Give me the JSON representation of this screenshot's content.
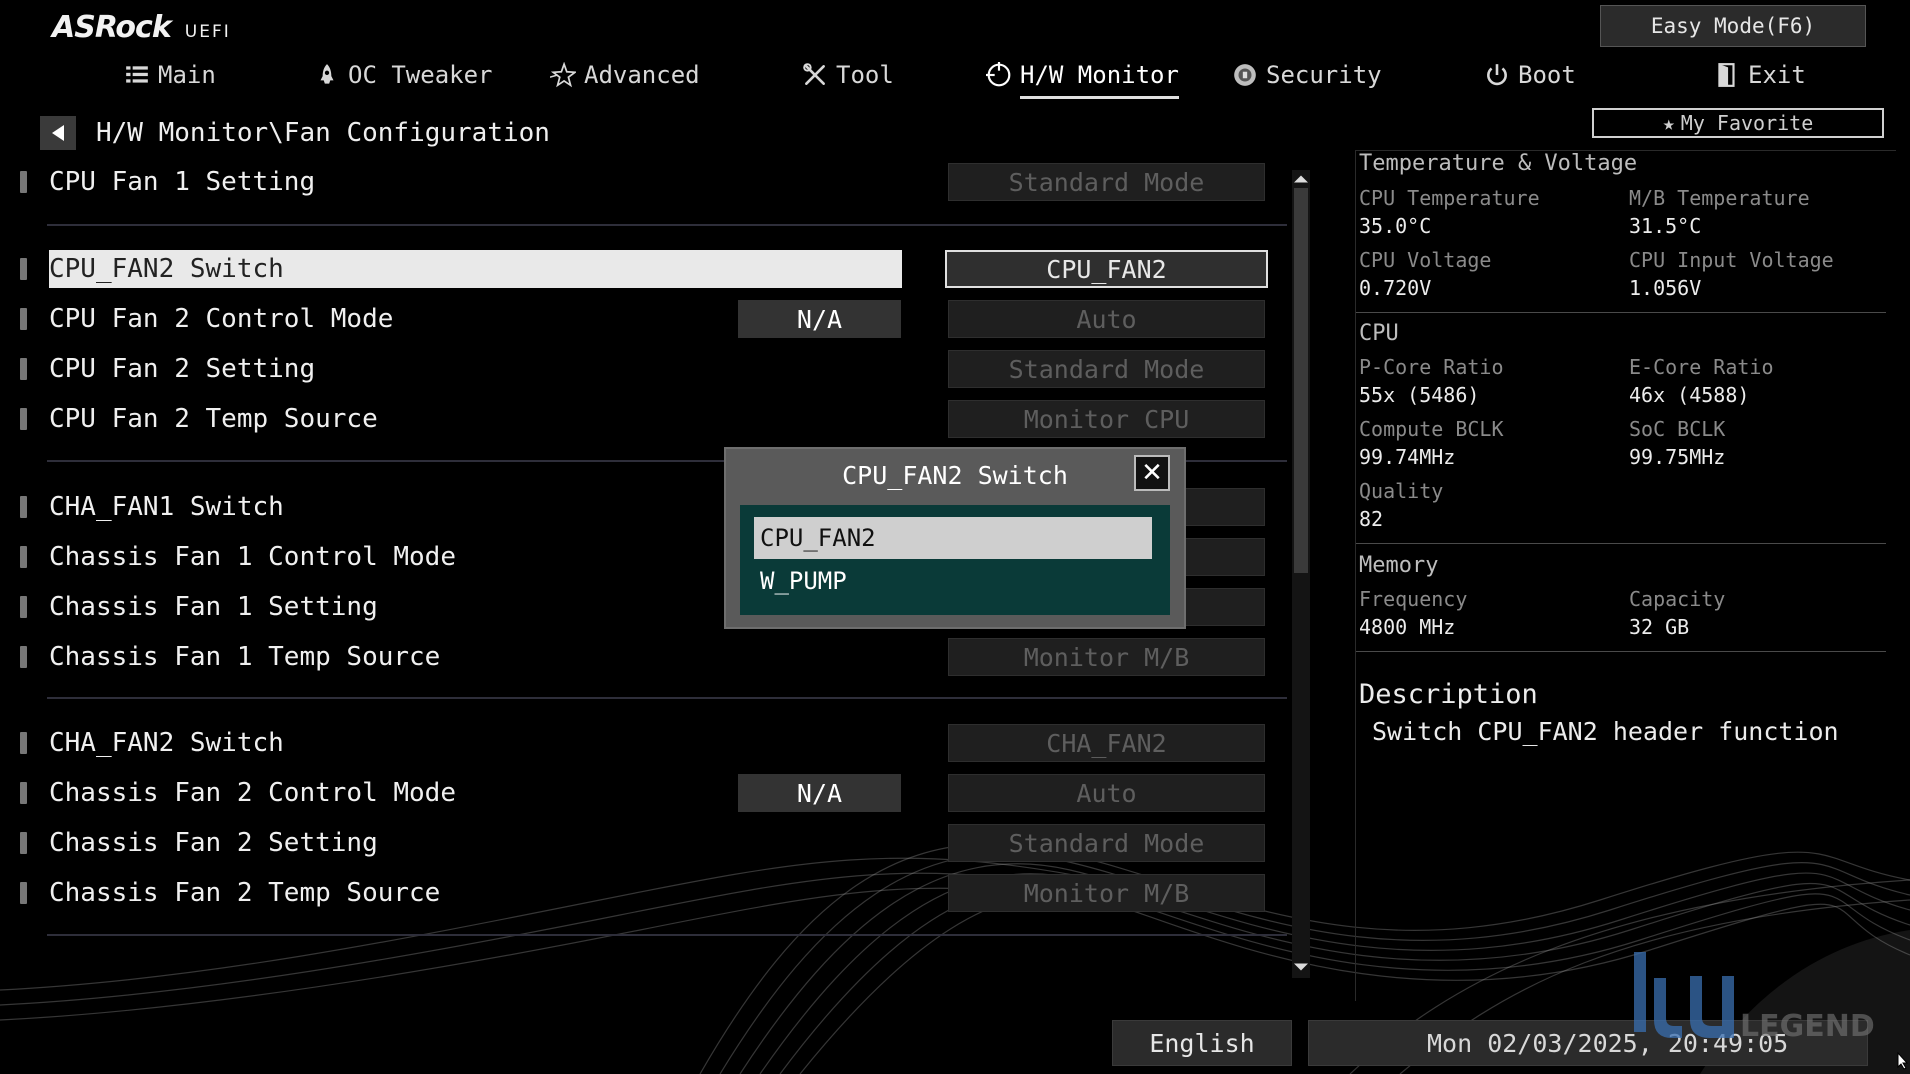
{
  "brand": {
    "name": "ASRock",
    "sub": "UEFI"
  },
  "easy_mode_label": "Easy Mode(F6)",
  "tabs": [
    {
      "label": "Main",
      "icon": "list-icon"
    },
    {
      "label": "OC Tweaker",
      "icon": "rocket-icon"
    },
    {
      "label": "Advanced",
      "icon": "star-icon"
    },
    {
      "label": "Tool",
      "icon": "tools-icon"
    },
    {
      "label": "H/W Monitor",
      "icon": "monitor-icon",
      "active": true
    },
    {
      "label": "Security",
      "icon": "shield-icon"
    },
    {
      "label": "Boot",
      "icon": "power-icon"
    },
    {
      "label": "Exit",
      "icon": "exit-door-icon"
    }
  ],
  "favorite_label": "My Favorite",
  "breadcrumb": "H/W Monitor\\Fan Configuration",
  "settings": [
    {
      "label": "CPU Fan 1 Setting",
      "value": "Standard Mode"
    },
    {
      "label": "CPU_FAN2 Switch",
      "value": "CPU_FAN2",
      "selected": true
    },
    {
      "label": "CPU Fan 2 Control Mode",
      "na": "N/A",
      "value": "Auto"
    },
    {
      "label": "CPU Fan 2 Setting",
      "value": "Standard Mode"
    },
    {
      "label": "CPU Fan 2 Temp Source",
      "value": "Monitor CPU"
    },
    {
      "label": "CHA_FAN1 Switch",
      "value": ""
    },
    {
      "label": "Chassis Fan 1 Control Mode",
      "value": ""
    },
    {
      "label": "Chassis Fan 1 Setting",
      "value": ""
    },
    {
      "label": "Chassis Fan 1 Temp Source",
      "value": "Monitor M/B"
    },
    {
      "label": "CHA_FAN2 Switch",
      "value": "CHA_FAN2"
    },
    {
      "label": "Chassis Fan 2 Control Mode",
      "na": "N/A",
      "value": "Auto"
    },
    {
      "label": "Chassis Fan 2 Setting",
      "value": "Standard Mode"
    },
    {
      "label": "Chassis Fan 2 Temp Source",
      "value": "Monitor M/B"
    }
  ],
  "popup": {
    "title": "CPU_FAN2 Switch",
    "options": [
      "CPU_FAN2",
      "W_PUMP"
    ],
    "selected_index": 0
  },
  "panel": {
    "temp_voltage": {
      "heading": "Temperature & Voltage",
      "cpu_temp_label": "CPU Temperature",
      "cpu_temp": "35.0°C",
      "mb_temp_label": "M/B Temperature",
      "mb_temp": "31.5°C",
      "cpu_volt_label": "CPU Voltage",
      "cpu_volt": "0.720V",
      "cpu_input_volt_label": "CPU Input Voltage",
      "cpu_input_volt": "1.056V"
    },
    "cpu": {
      "heading": "CPU",
      "pcore_label": "P-Core Ratio",
      "pcore": "55x (5486)",
      "ecore_label": "E-Core Ratio",
      "ecore": "46x (4588)",
      "bclk_label": "Compute BCLK",
      "bclk": "99.74MHz",
      "soc_label": "SoC BCLK",
      "soc": "99.75MHz",
      "quality_label": "Quality",
      "quality": "82"
    },
    "memory": {
      "heading": "Memory",
      "freq_label": "Frequency",
      "freq": "4800 MHz",
      "cap_label": "Capacity",
      "cap": "32 GB"
    },
    "description": {
      "title": "Description",
      "text": "Switch CPU_FAN2 header function"
    }
  },
  "footer": {
    "language": "English",
    "datetime": "Mon 02/03/2025, 20:49:05"
  },
  "watermark": "LEGEND",
  "colors": {
    "background": "#000000",
    "popup_list": "#0a3a38",
    "selected_row": "#e9e9e9"
  }
}
